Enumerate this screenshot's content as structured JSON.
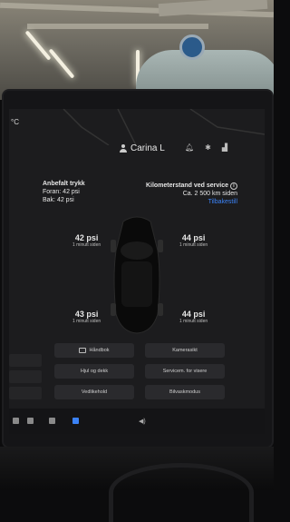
{
  "status": {
    "temperature": "°C",
    "user_name": "Carina L"
  },
  "recommended": {
    "title": "Anbefalt trykk",
    "front": "Foran: 42 psi",
    "rear": "Bak: 42 psi"
  },
  "service": {
    "title": "Kilometerstand ved service",
    "distance": "Ca. 2 500 km siden",
    "reset_link": "Tilbakestill"
  },
  "tires": {
    "front_left": {
      "psi": "42 psi",
      "ago": "1 minutt siden"
    },
    "front_right": {
      "psi": "44 psi",
      "ago": "1 minutt siden"
    },
    "rear_left": {
      "psi": "43 psi",
      "ago": "1 minutt siden"
    },
    "rear_right": {
      "psi": "44 psi",
      "ago": "1 minutt siden"
    }
  },
  "buttons": {
    "manual": "Håndbok",
    "camera": "Kamerasikt",
    "wheels": "Hjul og dekk",
    "service_mode": "Servicem. for visere",
    "maintenance": "Vedlikehold",
    "car_wash": "Bilvaskmodus"
  },
  "icons": {
    "user": "person-icon",
    "bell": "bell-icon",
    "bluetooth": "bluetooth-icon",
    "signal": "signal-icon",
    "info": "info-icon",
    "book": "book-icon",
    "volume": "volume-icon"
  },
  "colors": {
    "link": "#3b82f6",
    "screen_bg": "#1c1c1e",
    "button_bg": "#2a2a2d"
  }
}
